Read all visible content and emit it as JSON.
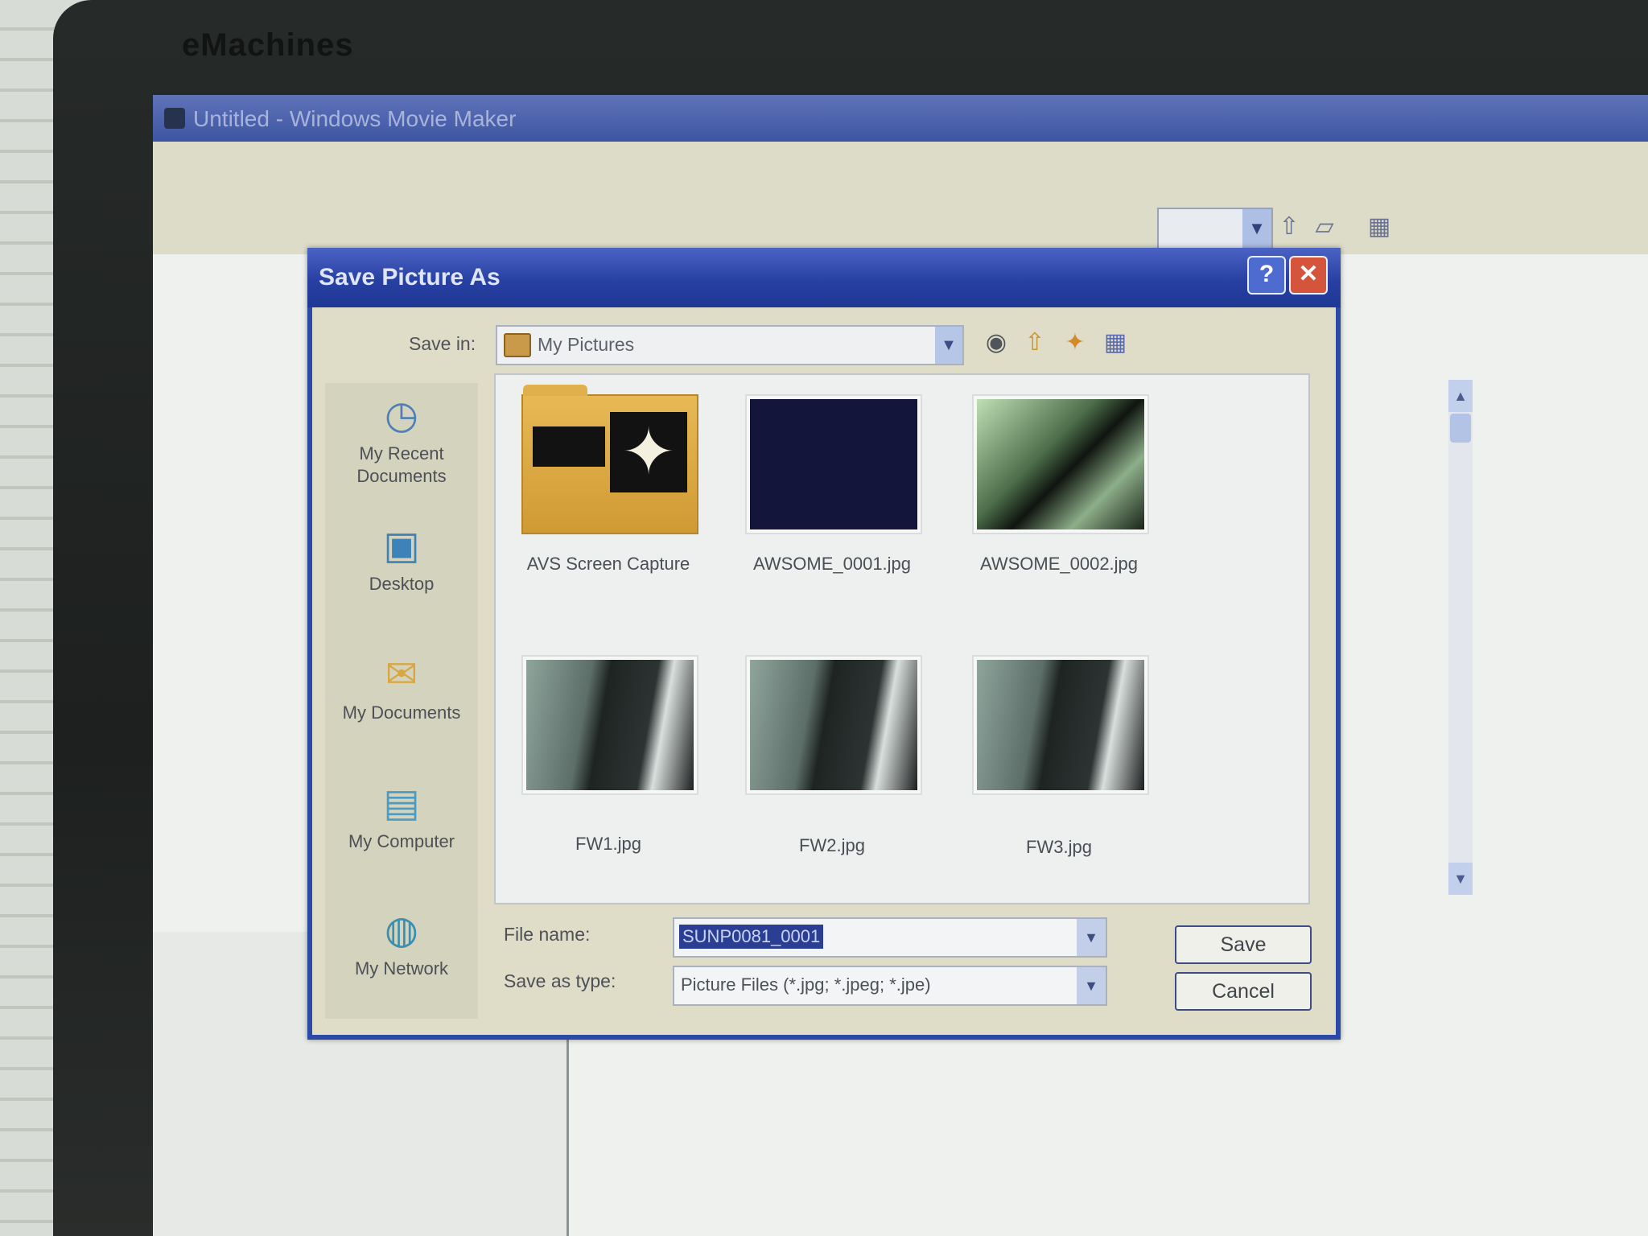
{
  "bezel": {
    "brand": "eMachines"
  },
  "background_window": {
    "title": "Untitled - Windows Movie Maker"
  },
  "dialog": {
    "title": "Save Picture As",
    "help_glyph": "?",
    "close_glyph": "✕",
    "save_in_label": "Save in:",
    "save_in_value": "My Pictures",
    "places": [
      {
        "label": "My Recent Documents",
        "icon": "recent-documents-icon"
      },
      {
        "label": "Desktop",
        "icon": "desktop-icon"
      },
      {
        "label": "My Documents",
        "icon": "my-documents-icon"
      },
      {
        "label": "My Computer",
        "icon": "my-computer-icon"
      },
      {
        "label": "My Network",
        "icon": "my-network-icon"
      }
    ],
    "files": [
      {
        "name": "AVS Screen Capture",
        "kind": "folder"
      },
      {
        "name": "AWSOME_0001.jpg",
        "kind": "image"
      },
      {
        "name": "AWSOME_0002.jpg",
        "kind": "image"
      },
      {
        "name": "FW1.jpg",
        "kind": "image"
      },
      {
        "name": "FW2.jpg",
        "kind": "image"
      },
      {
        "name": "FW3.jpg",
        "kind": "image"
      }
    ],
    "file_name_label": "File name:",
    "file_name_value": "SUNP0081_0001",
    "save_as_type_label": "Save as type:",
    "save_as_type_value": "Picture Files (*.jpg; *.jpeg; *.jpe)",
    "save_button": "Save",
    "cancel_button": "Cancel"
  },
  "colors": {
    "titlebar": "#2740a3",
    "dialog_bg": "#dfddc8",
    "selection": "#2a3f93",
    "close": "#d4553c"
  }
}
